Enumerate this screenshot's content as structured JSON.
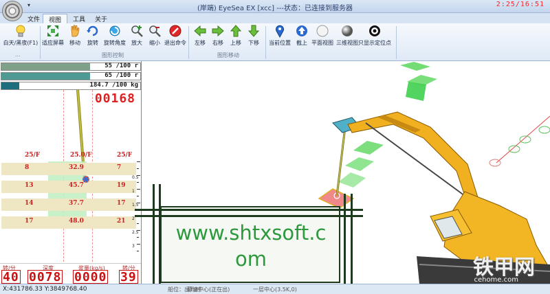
{
  "window": {
    "title": "(岸端) EyeSea EX [xcc] ---状态：已连接到服务器",
    "clock": "2:25/16:51"
  },
  "menu_tabs": [
    "文件",
    "视图",
    "工具",
    "关于"
  ],
  "active_tab": "视图",
  "ribbon": {
    "day_night": {
      "label": "白天/黑夜(F1)",
      "group": "..."
    },
    "view_group": {
      "label": "图形控制",
      "buttons": [
        "适应屏幕",
        "移动",
        "旋转",
        "旋转角度",
        "放大",
        "缩小",
        "退出命令"
      ]
    },
    "move_group": {
      "label": "图形移动",
      "buttons": [
        "左移",
        "右移",
        "上移",
        "下移"
      ]
    },
    "position_group": {
      "buttons": [
        "当前位置",
        "截上",
        "平面视图",
        "三维视图",
        "只显示定位点"
      ]
    }
  },
  "gauges": [
    {
      "text": "55 /100 r",
      "level": 0.64,
      "color": "#7fa089"
    },
    {
      "text": "65 /100 r",
      "level": 0.64,
      "color": "#4f9a92"
    },
    {
      "text": "184.7 /100 kg",
      "level": 0.13,
      "color": "#1e6e7e"
    }
  ],
  "depth_readout": "00168",
  "column_headers": [
    "25/F",
    "25.0/F",
    "25/F"
  ],
  "rows": [
    {
      "left": "8",
      "mid": "32.9",
      "right": "7"
    },
    {
      "left": "13",
      "mid": "45.7",
      "right": "19"
    },
    {
      "left": "14",
      "mid": "37.7",
      "right": "17"
    },
    {
      "left": "17",
      "mid": "48.0",
      "right": "21"
    }
  ],
  "ruler_labels": [
    "0.5",
    "1",
    "1.5",
    "2",
    "2.5",
    "3"
  ],
  "stats": [
    {
      "label": "转/分",
      "value": "40"
    },
    {
      "label": "深度",
      "value": "0078"
    },
    {
      "label": "浆量(kg/s)",
      "value": "0000"
    },
    {
      "label": "转/分",
      "value": "39"
    }
  ],
  "status": {
    "coords": "X:431786.33 Y:3849768.40",
    "fragments": [
      "船位：出力时",
      "幕墙中心(正在出)",
      "一层中心(3.5K,0)"
    ]
  },
  "overlay": {
    "watermark_line1": "www.shtxsoft.c",
    "watermark_line2": "om"
  },
  "brand": {
    "logo": "铁甲网",
    "url": "cehome.com"
  },
  "colors": {
    "accent_red": "#cc2020",
    "excavator_yellow": "#f0b020",
    "panel_green": "#5cd65c",
    "watermark_green": "#2c9a3c"
  }
}
